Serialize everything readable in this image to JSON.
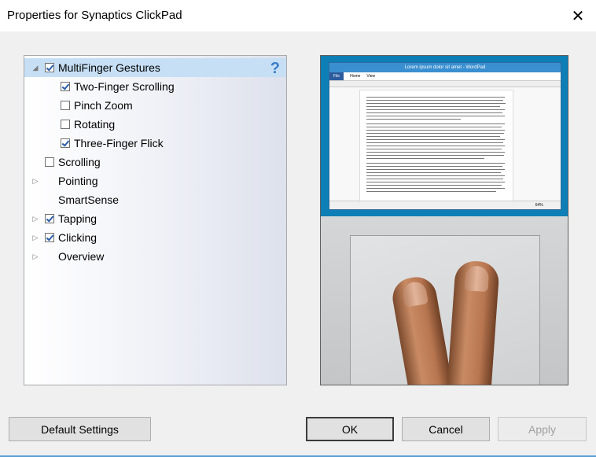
{
  "window": {
    "title": "Properties for Synaptics ClickPad"
  },
  "tree": {
    "items": [
      {
        "label": "MultiFinger Gestures",
        "expanded": true,
        "checkbox": true,
        "checked": true,
        "selected": true
      },
      {
        "label": "Two-Finger Scrolling",
        "checkbox": true,
        "checked": true
      },
      {
        "label": "Pinch Zoom",
        "checkbox": true,
        "checked": false
      },
      {
        "label": "Rotating",
        "checkbox": true,
        "checked": false
      },
      {
        "label": "Three-Finger Flick",
        "checkbox": true,
        "checked": true
      },
      {
        "label": "Scrolling",
        "checkbox": true,
        "checked": false
      },
      {
        "label": "Pointing",
        "expandable": true,
        "checkbox": false
      },
      {
        "label": "SmartSense",
        "checkbox": false
      },
      {
        "label": "Tapping",
        "expandable": true,
        "checkbox": true,
        "checked": true
      },
      {
        "label": "Clicking",
        "expandable": true,
        "checkbox": true,
        "checked": true
      },
      {
        "label": "Overview",
        "expandable": true,
        "checkbox": false
      }
    ],
    "help_icon": "question-mark-icon"
  },
  "preview": {
    "window_title": "Lorem ipsum dolor sit amet - WordPad",
    "ribbon_tabs": [
      "File",
      "Home",
      "View"
    ],
    "zoom": "64%"
  },
  "buttons": {
    "default_settings": "Default Settings",
    "ok": "OK",
    "cancel": "Cancel",
    "apply": "Apply"
  },
  "colors": {
    "selection": "#c6dff5",
    "accent": "#3b7dc9",
    "desktop": "#0d7fb6"
  }
}
